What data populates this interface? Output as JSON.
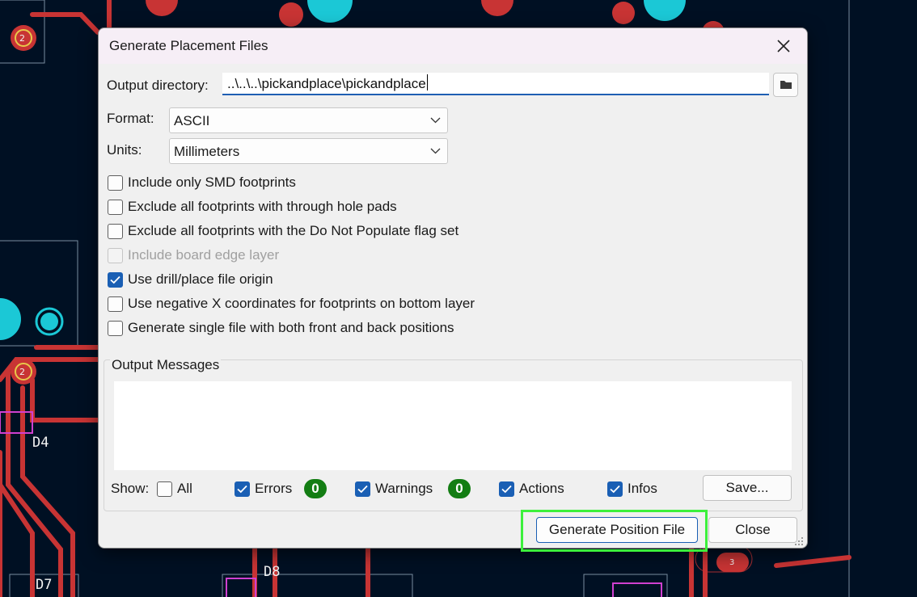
{
  "board": {
    "reference_labels": [
      "D4",
      "D7",
      "D8"
    ],
    "pad_numbers": [
      "2",
      "2",
      "3"
    ]
  },
  "dialog": {
    "title": "Generate Placement Files",
    "close_icon": "close-icon",
    "output_directory": {
      "label": "Output directory:",
      "value": "..\\..\\..\\pickandplace\\pickandplace",
      "browse_icon": "folder-icon"
    },
    "format": {
      "label": "Format:",
      "value": "ASCII"
    },
    "units": {
      "label": "Units:",
      "value": "Millimeters"
    },
    "options": [
      {
        "label": "Include only SMD footprints",
        "checked": false,
        "enabled": true
      },
      {
        "label": "Exclude all footprints with through hole pads",
        "checked": false,
        "enabled": true
      },
      {
        "label": "Exclude all footprints with the Do Not Populate flag set",
        "checked": false,
        "enabled": true
      },
      {
        "label": "Include board edge layer",
        "checked": false,
        "enabled": false
      },
      {
        "label": "Use drill/place file origin",
        "checked": true,
        "enabled": true
      },
      {
        "label": "Use negative X coordinates for footprints on bottom layer",
        "checked": false,
        "enabled": true
      },
      {
        "label": "Generate single file with both front and back positions",
        "checked": false,
        "enabled": true
      }
    ],
    "output_messages": {
      "title": "Output Messages",
      "show_label": "Show:",
      "filters": {
        "all": {
          "label": "All",
          "checked": false
        },
        "errors": {
          "label": "Errors",
          "checked": true,
          "count": "0"
        },
        "warnings": {
          "label": "Warnings",
          "checked": true,
          "count": "0"
        },
        "actions": {
          "label": "Actions",
          "checked": true
        },
        "infos": {
          "label": "Infos",
          "checked": true
        }
      },
      "save_button": "Save..."
    },
    "generate_button": "Generate Position File",
    "close_button": "Close"
  },
  "colors": {
    "board_background": "#001023",
    "copper_track": "#c83434",
    "pad": "#1bc8d6",
    "accent": "#1a5fb4",
    "badge": "#137d13",
    "highlight": "#3cf03c"
  }
}
